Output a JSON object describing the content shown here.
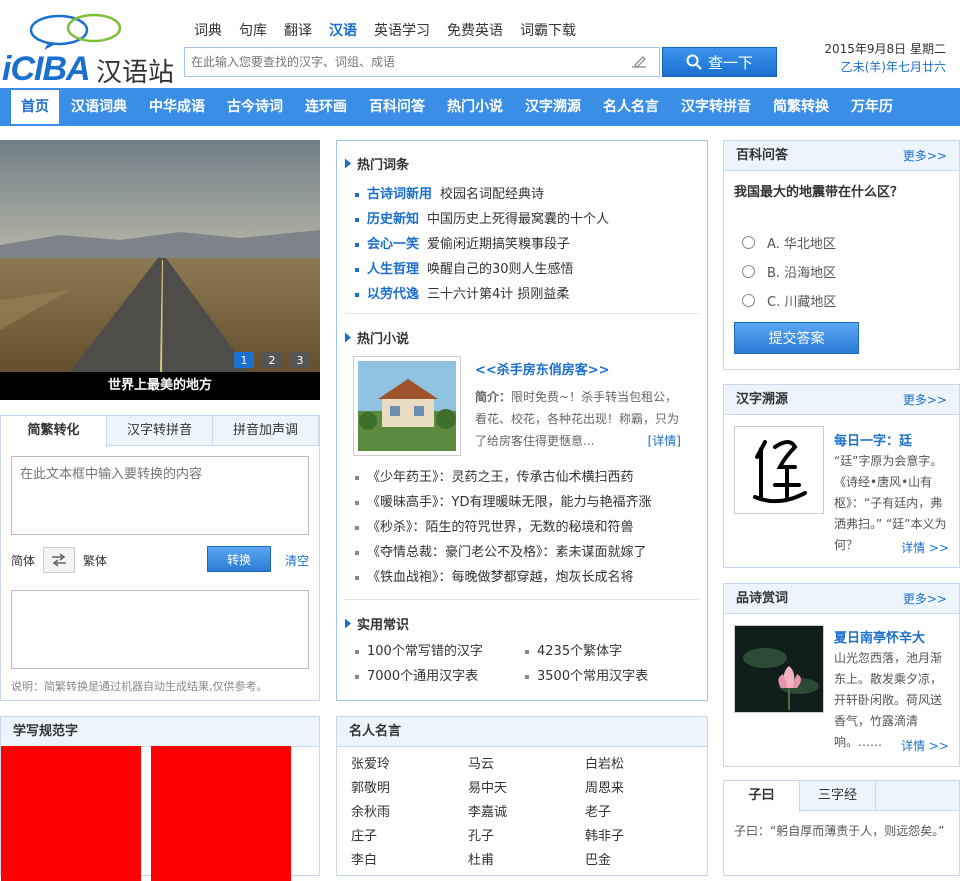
{
  "header": {
    "brand": "iCIBA",
    "brand_cn": "汉语站",
    "topnav": [
      "词典",
      "句库",
      "翻译",
      "汉语",
      "英语学习",
      "免费英语",
      "词霸下载"
    ],
    "search_placeholder": "在此输入您要查找的汉字、词组、成语",
    "search_button": "查一下",
    "date_line1": "2015年9月8日 星期二",
    "date_line2": "乙未(羊)年七月廿六"
  },
  "mainnav": [
    "首页",
    "汉语词典",
    "中华成语",
    "古今诗词",
    "连环画",
    "百科问答",
    "热门小说",
    "汉字溯源",
    "名人名言",
    "汉字转拼音",
    "简繁转换",
    "万年历"
  ],
  "carousel": {
    "caption": "世界上最美的地方",
    "dots": [
      "1",
      "2",
      "3"
    ]
  },
  "converter": {
    "tabs": [
      "简繁转化",
      "汉字转拼音",
      "拼音加声调"
    ],
    "input_placeholder": "在此文本框中输入要转换的内容",
    "simplified": "简体",
    "traditional": "繁体",
    "convert": "转换",
    "clear": "清空",
    "note": "说明：简繁转换是通过机器自动生成结果,仅供参考。"
  },
  "write": {
    "title": "学写规范字"
  },
  "hot_terms": {
    "title": "热门词条",
    "items": [
      {
        "tag": "古诗词新用",
        "text": "校园名词配经典诗"
      },
      {
        "tag": "历史新知",
        "text": "中国历史上死得最窝囊的十个人"
      },
      {
        "tag": "会心一笑",
        "text": "爱偷闲近期搞笑糗事段子"
      },
      {
        "tag": "人生哲理",
        "text": "唤醒自己的30则人生感悟"
      },
      {
        "tag": "以劳代逸",
        "text": "三十六计第4计 损刚益柔"
      }
    ]
  },
  "hot_novels": {
    "title": "热门小说",
    "feature_title": "<<杀手房东俏房客>>",
    "feature_intro_label": "简介：",
    "feature_intro": "限时免费~！杀手转当包租公，看花、校花，各种花出现！称霸，只为了给房客住得更惬意...",
    "detail": "[详情]",
    "items": [
      "《少年药王》：灵药之王，传承古仙术横扫西药",
      "《暖昧高手》：YD有理暖昧无限，能力与艳福齐涨",
      "《秒杀》：陌生的符咒世界，无数的秘境和符兽",
      "《夺情总裁：豪门老公不及格》：素未谋面就嫁了",
      "《铁血战袍》：每晚做梦都穿越，炮灰长成名将"
    ]
  },
  "practical": {
    "title": "实用常识",
    "items": [
      "100个常写错的汉字",
      "4235个繁体字",
      "7000个通用汉字表",
      "3500个常用汉字表"
    ]
  },
  "quotes": {
    "title": "名人名言",
    "names": [
      "张爱玲",
      "马云",
      "白岩松",
      "郭敬明",
      "易中天",
      "周恩来",
      "余秋雨",
      "李嘉诚",
      "老子",
      "庄子",
      "孔子",
      "韩非子",
      "李白",
      "杜甫",
      "巴金"
    ]
  },
  "qa": {
    "title": "百科问答",
    "more": "更多>>",
    "question": "我国最大的地震带在什么区？",
    "options": [
      "A. 华北地区",
      "B. 沿海地区",
      "C. 川藏地区"
    ],
    "submit": "提交答案"
  },
  "origin": {
    "title": "汉字溯源",
    "more": "更多>>",
    "subtitle": "每日一字：廷",
    "text": "“廷”字原为会意字。《诗经•唐风•山有枢》：“子有廷内，弗洒弗扫。” “廷”本义为何？",
    "detail": "详情 >>"
  },
  "poem": {
    "title": "品诗赏词",
    "more": "更多>>",
    "subtitle": "夏日南亭怀辛大",
    "text": "山光忽西落，池月渐东上。散发乘夕凉，开轩卧闲敞。荷风送香气，竹露滴清响。……",
    "detail": "详情 >>"
  },
  "ziyue": {
    "tabs": [
      "子曰",
      "三字经"
    ],
    "text": "子曰：“躬自厚而薄责于人，则远怨矣。”"
  },
  "colors": {
    "accent": "#1a6fcf",
    "nav": "#3a8ee6"
  }
}
